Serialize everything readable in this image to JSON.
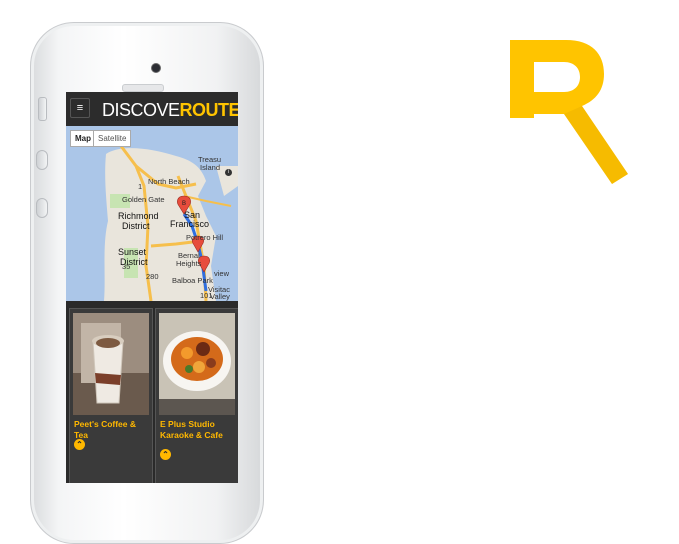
{
  "app": {
    "logo_prefix": "DISCOVE",
    "logo_suffix": "ROUTE",
    "menu_icon": "hamburger-icon"
  },
  "map": {
    "type_buttons": [
      "Map",
      "Satellite"
    ],
    "labels": {
      "richmond": "Richmond",
      "district": "District",
      "sunset": "Sunset",
      "district2": "District",
      "san": "San",
      "francisco": "Francisco",
      "north_beach": "North Beach",
      "treasure": "Treasu",
      "isl": "Island",
      "golden_gate": "Golden Gate",
      "potrero": "Potrero Hill",
      "bernal": "Bernal",
      "heights": "Heights",
      "balboa": "Balboa Park",
      "visitacion": "Visitac",
      "valley": "Valley",
      "bayview": "view",
      "hwy1": "1",
      "hwy35": "35",
      "hwy280": "280",
      "hwy101": "101"
    },
    "markers": [
      "B",
      "",
      ""
    ]
  },
  "cards": [
    {
      "title": "Peet's Coffee & Tea"
    },
    {
      "title": "E Plus Studio Karaoke & Cafe"
    }
  ],
  "colors": {
    "accent": "#ffc400",
    "card_title": "#ffb800",
    "marker": "#e74c3c"
  }
}
